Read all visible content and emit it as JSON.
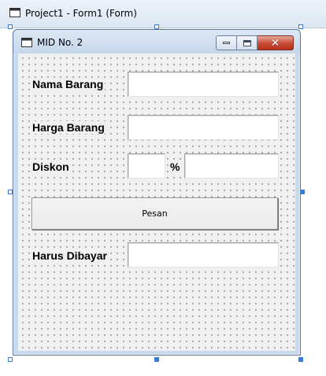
{
  "designer": {
    "title": "Project1 - Form1 (Form)",
    "icon": "form-window-icon"
  },
  "form": {
    "title": "MID No. 2",
    "icon": "form-window-icon",
    "controls": {
      "minimize": "minimize-icon",
      "maximize": "maximize-icon",
      "close_glyph": "✕"
    }
  },
  "fields": {
    "nama_barang": {
      "label": "Nama Barang",
      "value": ""
    },
    "harga_barang": {
      "label": "Harga Barang",
      "value": ""
    },
    "diskon": {
      "label": "Diskon",
      "percent_value": "",
      "percent_sign": "%",
      "amount_value": ""
    },
    "harus_dibayar": {
      "label": "Harus Dibayar",
      "value": ""
    }
  },
  "buttons": {
    "pesan": "Pesan"
  },
  "colors": {
    "selection_handle": "#3a7bd5",
    "close_button": "#c74a34",
    "form_background": "#f0f0f0"
  }
}
